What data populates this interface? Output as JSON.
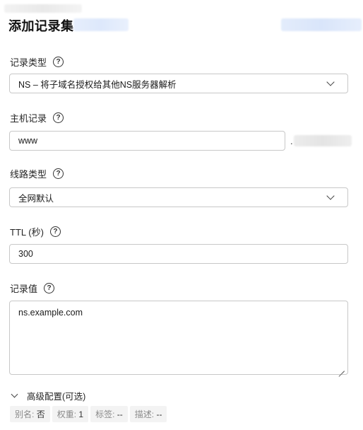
{
  "header": {
    "title": "添加记录集"
  },
  "record_type": {
    "label": "记录类型",
    "value": "NS – 将子域名授权给其他NS服务器解析"
  },
  "host": {
    "label": "主机记录",
    "value": "www",
    "suffix_dot": "."
  },
  "line_type": {
    "label": "线路类型",
    "value": "全网默认"
  },
  "ttl": {
    "label": "TTL (秒)",
    "value": "300"
  },
  "record_value": {
    "label": "记录值",
    "value": "ns.example.com"
  },
  "advanced": {
    "label": "高级配置(可选)",
    "tags": [
      {
        "key": "别名:",
        "value": "否"
      },
      {
        "key": "权重:",
        "value": "1"
      },
      {
        "key": "标签:",
        "value": "--"
      },
      {
        "key": "描述:",
        "value": "--"
      }
    ]
  },
  "help_glyph": "?"
}
